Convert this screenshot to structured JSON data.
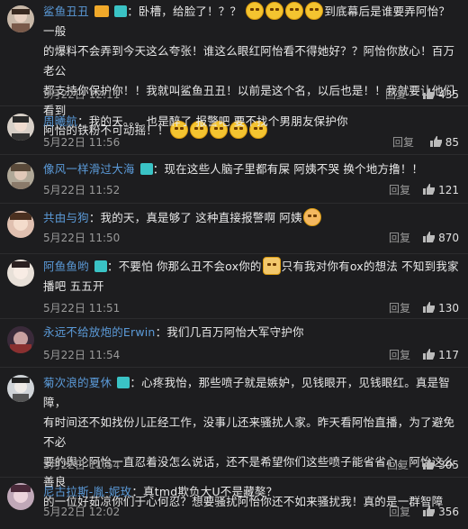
{
  "comments": [
    {
      "username": "鲨鱼丑丑",
      "text_a": "：卧槽，给脸了！？？",
      "text_b": "到底幕后是谁要弄阿怡？一般",
      "text_c": "的爆料不会弄到今天这么夸张！谁这么眼红阿怡看不得她好？？阿怡你放心！百万老公",
      "text_d": "都支持你保护你！！我就叫鲨鱼丑丑！以前是这个名，以后也是！！我就要让他们看到",
      "text_e": "阿怡的铁粉不可动摇！！",
      "time": "5月22日 12:11",
      "reply": "回复",
      "likes": "435"
    },
    {
      "username": "周曦航",
      "text": "：我的天。。。也是醉了 报警吧 要不找个男朋友保护你",
      "time": "5月22日 11:56",
      "reply": "回复",
      "likes": "85"
    },
    {
      "username": "像风一样滑过大海",
      "text": "：现在这些人脑子里都有屎 阿姨不哭 换个地方撸！！",
      "time": "5月22日 11:52",
      "reply": "回复",
      "likes": "121"
    },
    {
      "username": "共由与狗",
      "text": "：我的天，真是够了 这种直接报警啊 阿姨",
      "time": "5月22日 11:50",
      "reply": "回复",
      "likes": "870"
    },
    {
      "username": "阿鱼鱼哟",
      "text_a": "：不要怕 你那么丑不会ox你的",
      "text_b": "只有我对你有ox的想法 不知到我家",
      "text_c": "播吧 五五开",
      "time": "5月22日 11:51",
      "reply": "回复",
      "likes": "130"
    },
    {
      "username": "永远不给放炮的Erwin",
      "text": "：我们几百万阿怡大军守护你",
      "time": "5月22日 11:54",
      "reply": "回复",
      "likes": "117"
    },
    {
      "username": "菊次浪的夏休",
      "text_a": "：心疼我怡，那些喷子就是嫉妒，见钱眼开，见钱眼红。真是智障，",
      "text_b": "有时间还不如找份儿正经工作，没事儿还来骚扰人家。昨天看阿怡直播，为了避免不必",
      "text_c": "要的舆论阿怡一直忍着没怎么说话，还不是希望你们这些喷子能省省心。阿怡这么善良",
      "text_d": "的一位好茹凉你们于心何忍？想要骚扰阿怡你还不如来骚扰我！真的是一群智障",
      "time": "5月22日 11:54",
      "reply": "回复",
      "likes": "305"
    },
    {
      "username": "尼古拉斯-胤-妮玫",
      "text": "：真tmd欺负大U不是藏獒？",
      "time": "5月22日 12:02",
      "reply": "回复",
      "likes": "356"
    }
  ],
  "colors": {
    "background": "#1d1d1f",
    "username": "#5b9ad8",
    "text": "#e8e8e8",
    "muted": "#9a9a9a"
  },
  "icons": {
    "like": "thumbs-up-icon",
    "vip": "vip-badge-icon",
    "camera": "camera-badge-icon",
    "emoji": "angry-emoji-icon"
  }
}
